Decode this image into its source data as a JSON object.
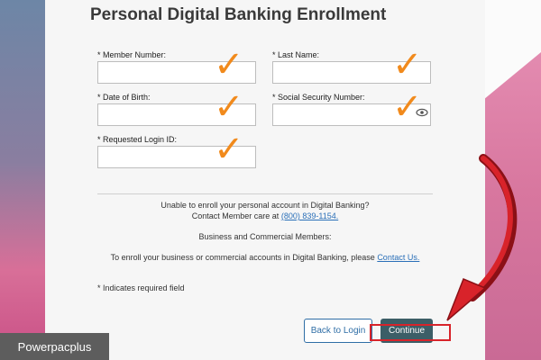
{
  "page": {
    "title": "Personal Digital Banking Enrollment"
  },
  "form": {
    "member_number_label": "* Member Number:",
    "last_name_label": "* Last Name:",
    "dob_label": "* Date of Birth:",
    "ssn_label": "* Social Security Number:",
    "login_id_label": "* Requested Login ID:",
    "member_number_value": "",
    "last_name_value": "",
    "dob_value": "",
    "ssn_value": "",
    "login_id_value": ""
  },
  "annotations": {
    "check_glyph": "✓",
    "check_color": "#f18a1c",
    "arrow_color": "#d8232a"
  },
  "info": {
    "line1": "Unable to enroll your personal account in Digital Banking?",
    "line2_prefix": "Contact Member care at",
    "phone": "(800) 839-1154.",
    "business_heading": "Business and Commercial Members:",
    "business_text": "To enroll your business or commercial accounts in Digital Banking, please",
    "contact_link": "Contact Us.",
    "required_note": "* Indicates required field"
  },
  "actions": {
    "back_label": "Back to Login",
    "continue_label": "Continue"
  },
  "watermark": {
    "text": "Powerpacplus"
  }
}
